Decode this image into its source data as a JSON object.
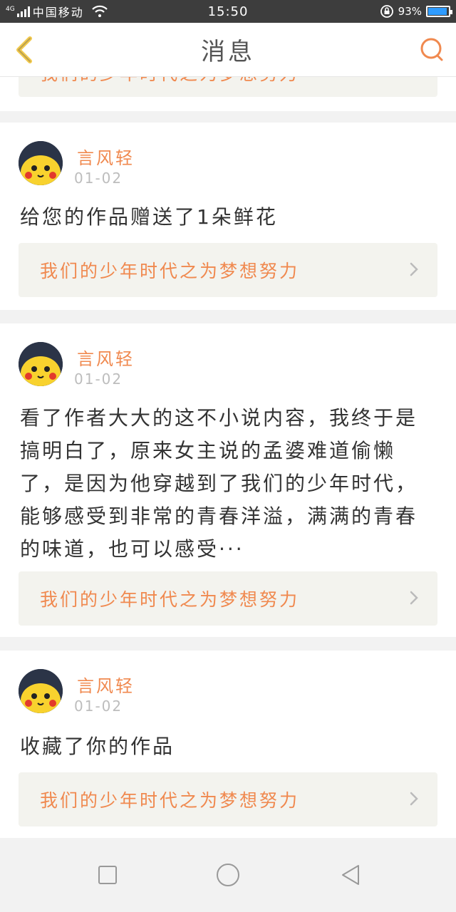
{
  "status_bar": {
    "network": "4G",
    "carrier": "中国移动",
    "time": "15:50",
    "battery": "93%"
  },
  "header": {
    "title": "消息"
  },
  "work_title": "我们的少年时代之为梦想努力",
  "messages": [
    {
      "user": "言风轻",
      "date": "01-02",
      "text": "给您的作品赠送了1朵鲜花"
    },
    {
      "user": "言风轻",
      "date": "01-02",
      "text": "看了作者大大的这不小说内容，我终于是搞明白了，原来女主说的孟婆难道偷懒了，是因为他穿越到了我们的少年时代，能够感受到非常的青春洋溢，满满的青春的味道，也可以感受···"
    },
    {
      "user": "言风轻",
      "date": "01-02",
      "text": "收藏了你的作品"
    }
  ],
  "colors": {
    "accent": "#f0894f",
    "status_bar": "#3d3d3d",
    "link_bg": "#f3f3ee",
    "back": "#f2c94c"
  }
}
